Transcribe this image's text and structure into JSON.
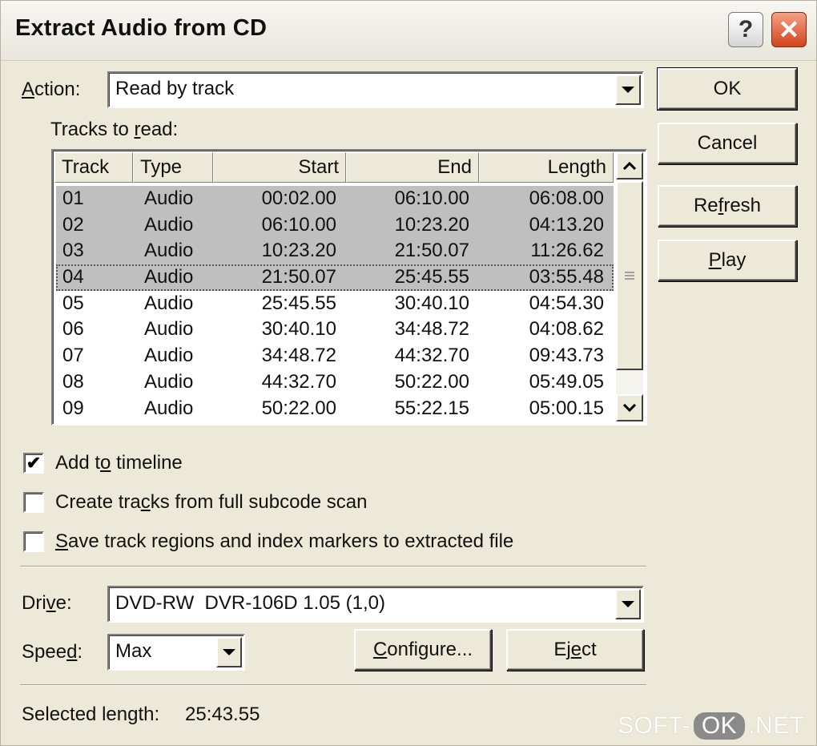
{
  "window": {
    "title": "Extract Audio from CD",
    "help_glyph": "?",
    "close_glyph": "✕"
  },
  "action": {
    "label_pre": "",
    "label_mnemonic": "A",
    "label_post": "ction:",
    "value": "Read by track"
  },
  "tracks": {
    "label_pre": "Tracks to ",
    "label_mnemonic": "r",
    "label_post": "ead:",
    "columns": [
      "Track",
      "Type",
      "Start",
      "End",
      "Length"
    ],
    "rows": [
      {
        "track": "01",
        "type": "Audio",
        "start": "00:02.00",
        "end": "06:10.00",
        "length": "06:08.00",
        "selected": true
      },
      {
        "track": "02",
        "type": "Audio",
        "start": "06:10.00",
        "end": "10:23.20",
        "length": "04:13.20",
        "selected": true
      },
      {
        "track": "03",
        "type": "Audio",
        "start": "10:23.20",
        "end": "21:50.07",
        "length": "11:26.62",
        "selected": true
      },
      {
        "track": "04",
        "type": "Audio",
        "start": "21:50.07",
        "end": "25:45.55",
        "length": "03:55.48",
        "selected": true,
        "focused": true
      },
      {
        "track": "05",
        "type": "Audio",
        "start": "25:45.55",
        "end": "30:40.10",
        "length": "04:54.30",
        "selected": false
      },
      {
        "track": "06",
        "type": "Audio",
        "start": "30:40.10",
        "end": "34:48.72",
        "length": "04:08.62",
        "selected": false
      },
      {
        "track": "07",
        "type": "Audio",
        "start": "34:48.72",
        "end": "44:32.70",
        "length": "09:43.73",
        "selected": false
      },
      {
        "track": "08",
        "type": "Audio",
        "start": "44:32.70",
        "end": "50:22.00",
        "length": "05:49.05",
        "selected": false
      },
      {
        "track": "09",
        "type": "Audio",
        "start": "50:22.00",
        "end": "55:22.15",
        "length": "05:00.15",
        "selected": false
      }
    ]
  },
  "buttons": {
    "ok": "OK",
    "cancel": "Cancel",
    "refresh_pre": "Re",
    "refresh_mnemonic": "f",
    "refresh_post": "resh",
    "play_pre": "",
    "play_mnemonic": "P",
    "play_post": "lay",
    "configure_pre": "",
    "configure_mnemonic": "C",
    "configure_post": "onfigure...",
    "eject_pre": "Ej",
    "eject_mnemonic": "e",
    "eject_post": "ct"
  },
  "options": {
    "add_timeline_pre": "Add t",
    "add_timeline_mnemonic": "o",
    "add_timeline_post": " timeline",
    "add_timeline_checked": true,
    "subcode_pre": "Create tra",
    "subcode_mnemonic": "c",
    "subcode_post": "ks from full subcode scan",
    "subcode_checked": false,
    "save_regions_pre": "",
    "save_regions_mnemonic": "S",
    "save_regions_post": "ave track regions and index markers to extracted file",
    "save_regions_checked": false,
    "check_glyph": "✔"
  },
  "drive": {
    "label_pre": "Dri",
    "label_mnemonic": "v",
    "label_post": "e:",
    "value": "DVD-RW  DVR-106D 1.05 (1,0)"
  },
  "speed": {
    "label_pre": "Spee",
    "label_mnemonic": "d",
    "label_post": ":",
    "value": "Max"
  },
  "status": {
    "label": "Selected length:",
    "value": "25:43.55"
  },
  "watermark": {
    "pre": "SOFT-",
    "box": "OK",
    "post": ".NET"
  }
}
